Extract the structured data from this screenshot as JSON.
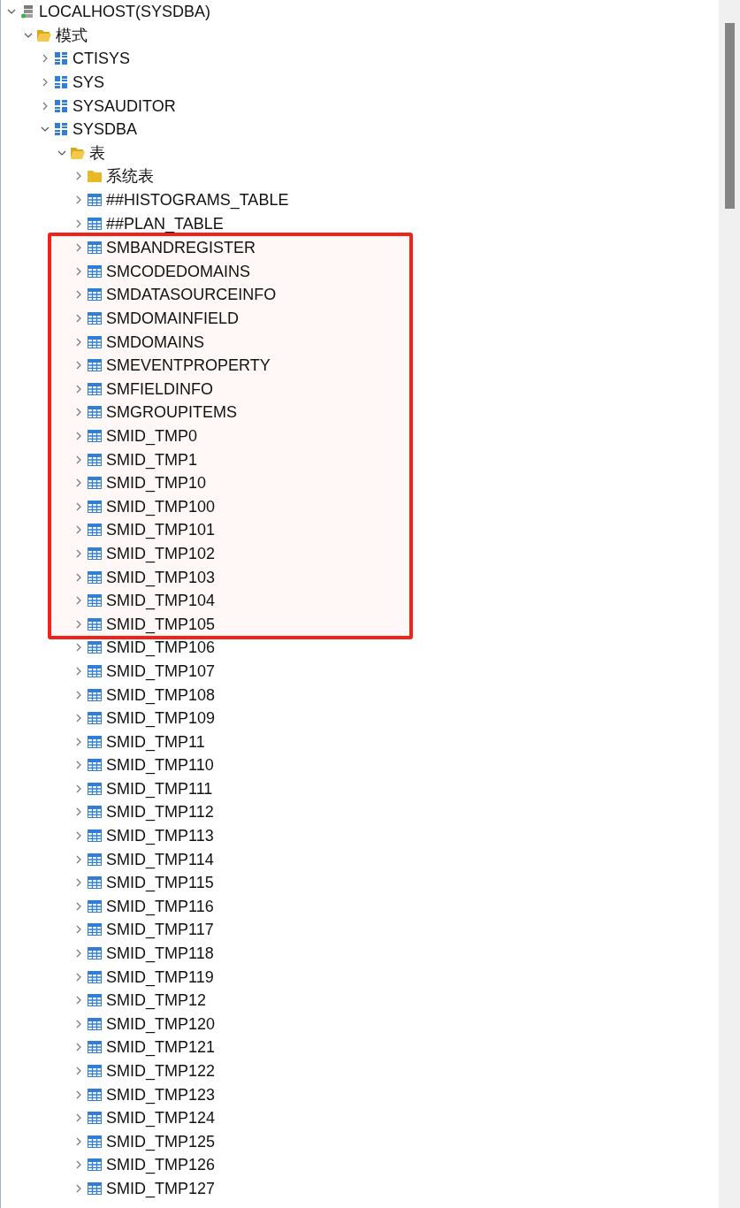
{
  "tree": [
    {
      "label": "LOCALHOST(SYSDBA)",
      "kind": "server",
      "expanded": true,
      "children": [
        {
          "label": "模式",
          "kind": "folder",
          "expanded": true,
          "children": [
            {
              "label": "CTISYS",
              "kind": "schema",
              "expanded": false
            },
            {
              "label": "SYS",
              "kind": "schema",
              "expanded": false
            },
            {
              "label": "SYSAUDITOR",
              "kind": "schema",
              "expanded": false
            },
            {
              "label": "SYSDBA",
              "kind": "schema",
              "expanded": true,
              "children": [
                {
                  "label": "表",
                  "kind": "folder",
                  "expanded": true,
                  "children": [
                    {
                      "label": "系统表",
                      "kind": "folder",
                      "expanded": false,
                      "highlighted": false
                    },
                    {
                      "label": "##HISTOGRAMS_TABLE",
                      "kind": "table",
                      "expanded": false,
                      "highlighted": false
                    },
                    {
                      "label": "##PLAN_TABLE",
                      "kind": "table",
                      "expanded": false,
                      "highlighted": false
                    },
                    {
                      "label": "SMBANDREGISTER",
                      "kind": "table",
                      "expanded": false,
                      "highlighted": true
                    },
                    {
                      "label": "SMCODEDOMAINS",
                      "kind": "table",
                      "expanded": false,
                      "highlighted": true
                    },
                    {
                      "label": "SMDATASOURCEINFO",
                      "kind": "table",
                      "expanded": false,
                      "highlighted": true
                    },
                    {
                      "label": "SMDOMAINFIELD",
                      "kind": "table",
                      "expanded": false,
                      "highlighted": true
                    },
                    {
                      "label": "SMDOMAINS",
                      "kind": "table",
                      "expanded": false,
                      "highlighted": true
                    },
                    {
                      "label": "SMEVENTPROPERTY",
                      "kind": "table",
                      "expanded": false,
                      "highlighted": true
                    },
                    {
                      "label": "SMFIELDINFO",
                      "kind": "table",
                      "expanded": false,
                      "highlighted": true
                    },
                    {
                      "label": "SMGROUPITEMS",
                      "kind": "table",
                      "expanded": false,
                      "highlighted": true
                    },
                    {
                      "label": "SMID_TMP0",
                      "kind": "table",
                      "expanded": false,
                      "highlighted": true
                    },
                    {
                      "label": "SMID_TMP1",
                      "kind": "table",
                      "expanded": false,
                      "highlighted": true
                    },
                    {
                      "label": "SMID_TMP10",
                      "kind": "table",
                      "expanded": false,
                      "highlighted": true
                    },
                    {
                      "label": "SMID_TMP100",
                      "kind": "table",
                      "expanded": false,
                      "highlighted": true
                    },
                    {
                      "label": "SMID_TMP101",
                      "kind": "table",
                      "expanded": false,
                      "highlighted": true
                    },
                    {
                      "label": "SMID_TMP102",
                      "kind": "table",
                      "expanded": false,
                      "highlighted": true
                    },
                    {
                      "label": "SMID_TMP103",
                      "kind": "table",
                      "expanded": false,
                      "highlighted": true
                    },
                    {
                      "label": "SMID_TMP104",
                      "kind": "table",
                      "expanded": false,
                      "highlighted": true
                    },
                    {
                      "label": "SMID_TMP105",
                      "kind": "table",
                      "expanded": false,
                      "highlighted": true
                    },
                    {
                      "label": "SMID_TMP106",
                      "kind": "table",
                      "expanded": false,
                      "highlighted": false
                    },
                    {
                      "label": "SMID_TMP107",
                      "kind": "table",
                      "expanded": false,
                      "highlighted": false
                    },
                    {
                      "label": "SMID_TMP108",
                      "kind": "table",
                      "expanded": false,
                      "highlighted": false
                    },
                    {
                      "label": "SMID_TMP109",
                      "kind": "table",
                      "expanded": false,
                      "highlighted": false
                    },
                    {
                      "label": "SMID_TMP11",
                      "kind": "table",
                      "expanded": false,
                      "highlighted": false
                    },
                    {
                      "label": "SMID_TMP110",
                      "kind": "table",
                      "expanded": false,
                      "highlighted": false
                    },
                    {
                      "label": "SMID_TMP111",
                      "kind": "table",
                      "expanded": false,
                      "highlighted": false
                    },
                    {
                      "label": "SMID_TMP112",
                      "kind": "table",
                      "expanded": false,
                      "highlighted": false
                    },
                    {
                      "label": "SMID_TMP113",
                      "kind": "table",
                      "expanded": false,
                      "highlighted": false
                    },
                    {
                      "label": "SMID_TMP114",
                      "kind": "table",
                      "expanded": false,
                      "highlighted": false
                    },
                    {
                      "label": "SMID_TMP115",
                      "kind": "table",
                      "expanded": false,
                      "highlighted": false
                    },
                    {
                      "label": "SMID_TMP116",
                      "kind": "table",
                      "expanded": false,
                      "highlighted": false
                    },
                    {
                      "label": "SMID_TMP117",
                      "kind": "table",
                      "expanded": false,
                      "highlighted": false
                    },
                    {
                      "label": "SMID_TMP118",
                      "kind": "table",
                      "expanded": false,
                      "highlighted": false
                    },
                    {
                      "label": "SMID_TMP119",
                      "kind": "table",
                      "expanded": false,
                      "highlighted": false
                    },
                    {
                      "label": "SMID_TMP12",
                      "kind": "table",
                      "expanded": false,
                      "highlighted": false
                    },
                    {
                      "label": "SMID_TMP120",
                      "kind": "table",
                      "expanded": false,
                      "highlighted": false
                    },
                    {
                      "label": "SMID_TMP121",
                      "kind": "table",
                      "expanded": false,
                      "highlighted": false
                    },
                    {
                      "label": "SMID_TMP122",
                      "kind": "table",
                      "expanded": false,
                      "highlighted": false
                    },
                    {
                      "label": "SMID_TMP123",
                      "kind": "table",
                      "expanded": false,
                      "highlighted": false
                    },
                    {
                      "label": "SMID_TMP124",
                      "kind": "table",
                      "expanded": false,
                      "highlighted": false
                    },
                    {
                      "label": "SMID_TMP125",
                      "kind": "table",
                      "expanded": false,
                      "highlighted": false
                    },
                    {
                      "label": "SMID_TMP126",
                      "kind": "table",
                      "expanded": false,
                      "highlighted": false
                    },
                    {
                      "label": "SMID_TMP127",
                      "kind": "table",
                      "expanded": false,
                      "highlighted": false
                    }
                  ]
                }
              ]
            }
          ]
        }
      ]
    }
  ]
}
